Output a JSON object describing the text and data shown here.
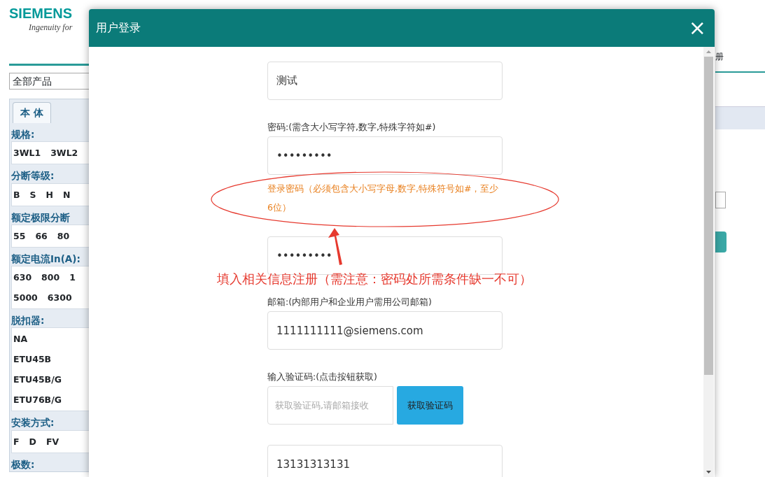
{
  "header": {
    "logo": "SIEMENS",
    "tagline": "Ingenuity for",
    "right_link": "册"
  },
  "category_select": {
    "value": "全部产品"
  },
  "tabs": [
    {
      "label": "本 体",
      "selected": true
    }
  ],
  "filters": [
    {
      "title": "规格:",
      "rows": [
        [
          "3WL1",
          "3WL2"
        ]
      ]
    },
    {
      "title": "分断等级:",
      "rows": [
        [
          "B",
          "S",
          "H",
          "N"
        ]
      ]
    },
    {
      "title": "额定极限分断",
      "rows": [
        [
          "55",
          "66",
          "80"
        ]
      ]
    },
    {
      "title": "额定电流In(A):",
      "rows": [
        [
          "630",
          "800",
          "1"
        ],
        [
          "5000",
          "6300"
        ]
      ]
    },
    {
      "title": "脱扣器:",
      "rows": [
        [
          "NA"
        ],
        [
          "ETU45B"
        ],
        [
          "ETU45B/G"
        ],
        [
          "ETU76B/G"
        ]
      ]
    },
    {
      "title": "安装方式:",
      "rows": [
        [
          "F",
          "D",
          "FV"
        ]
      ]
    },
    {
      "title": "极数:"
    }
  ],
  "dialog": {
    "title": "用户登录",
    "close": "×",
    "fields": [
      {
        "kind": "text",
        "value": "测试"
      },
      {
        "kind": "text",
        "label": "密码:(需含大小写字符,数字,特殊字符如#)",
        "value": "•••••••••",
        "hint": "登录密码（必须包含大小写字母,数字,特殊符号如#，至少6位）"
      },
      {
        "kind": "text",
        "value": "•••••••••"
      },
      {
        "kind": "text",
        "label": "邮箱:(内部用户和企业用户需用公司邮箱)",
        "value": "1111111111@siemens.com"
      },
      {
        "kind": "code",
        "label": "输入验证码:(点击按钮获取)",
        "placeholder": "获取验证码,请邮箱接收",
        "button": "获取验证码"
      },
      {
        "kind": "text",
        "value": "13131313131"
      }
    ],
    "annotation": "填入相关信息注册（需注意：密码处所需条件缺一不可）"
  }
}
